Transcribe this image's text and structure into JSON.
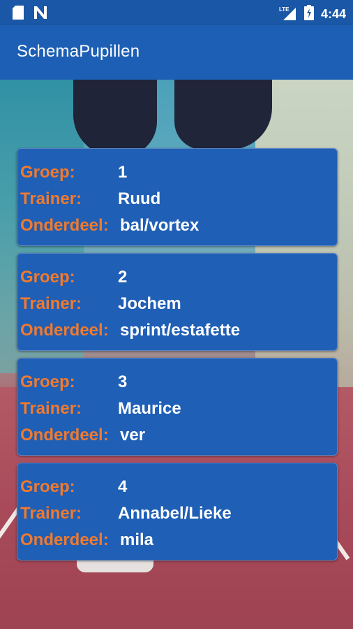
{
  "status_bar": {
    "time": "4:44",
    "network_label": "LTE",
    "icons": [
      "sd-card-icon",
      "n-notification-icon",
      "lte-signal-icon",
      "battery-charging-icon"
    ]
  },
  "app_bar": {
    "title": "SchemaPupillen"
  },
  "colors": {
    "primary": "#1d5fb4",
    "card_bg": "#1f5fb6",
    "label": "#f07a2e",
    "value": "#ffffff"
  },
  "labels": {
    "groep": "Groep:",
    "trainer": "Trainer:",
    "onderdeel": "Onderdeel:"
  },
  "groups": [
    {
      "groep": "1",
      "trainer": "Ruud",
      "onderdeel": "bal/vortex"
    },
    {
      "groep": "2",
      "trainer": "Jochem",
      "onderdeel": "sprint/estafette"
    },
    {
      "groep": "3",
      "trainer": "Maurice",
      "onderdeel": "ver"
    },
    {
      "groep": "4",
      "trainer": "Annabel/Lieke",
      "onderdeel": "mila"
    }
  ]
}
